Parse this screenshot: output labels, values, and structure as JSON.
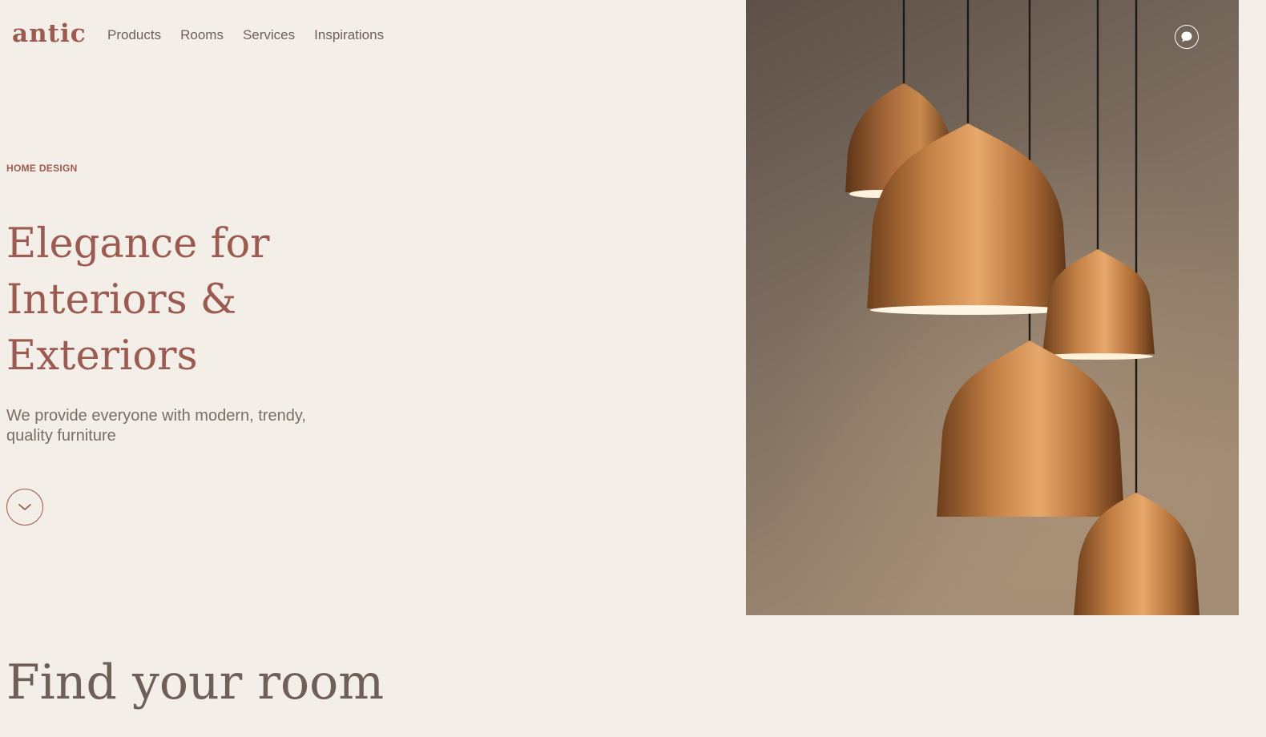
{
  "header": {
    "logo": "antic",
    "nav": [
      "Products",
      "Rooms",
      "Services",
      "Inspirations"
    ]
  },
  "hero": {
    "eyebrow": "HOME DESIGN",
    "title_lines": [
      "Elegance for",
      "Interiors &",
      "Exteriors"
    ],
    "subtitle_lines": [
      "We provide everyone with modern, trendy,",
      "quality furniture"
    ],
    "scroll_icon": "chevron-down-icon",
    "image": "copper-pendant-lamps-photo"
  },
  "chat": {
    "icon": "chat-bubble-icon"
  },
  "rooms_section": {
    "title": "Find your room"
  },
  "colors": {
    "background": "#f3eee8",
    "accent": "#9b5b50",
    "text": "#6e6058",
    "copper": "#c98a4c"
  }
}
